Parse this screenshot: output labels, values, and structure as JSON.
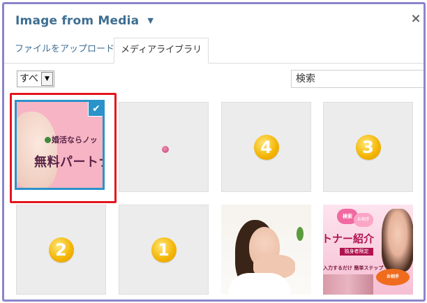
{
  "header": {
    "title": "Image from Media",
    "title_caret": "▼",
    "close_icon": "×"
  },
  "tabs": [
    {
      "label": "ファイルをアップロード",
      "active": false
    },
    {
      "label": "メディアライブラリ",
      "active": true
    }
  ],
  "filter": {
    "selected": "すべ",
    "arrow": "▼"
  },
  "search": {
    "value": "検索"
  },
  "grid": {
    "items": [
      {
        "kind": "ad",
        "selected": true,
        "line1": "婚活ならノッ",
        "line2": "無料パートナ"
      },
      {
        "kind": "dot",
        "selected": false
      },
      {
        "kind": "number",
        "value": "4",
        "selected": false
      },
      {
        "kind": "number",
        "value": "3",
        "selected": false
      },
      {
        "kind": "number",
        "value": "2",
        "selected": false
      },
      {
        "kind": "number",
        "value": "1",
        "selected": false
      },
      {
        "kind": "photo-woman",
        "selected": false
      },
      {
        "kind": "promo",
        "selected": false,
        "title": "トナー紹介",
        "sub": "独身者限定",
        "steps": "入力するだけ 簡単ステップ",
        "head1": "検索",
        "head2": "お相手",
        "badge": "お相手"
      }
    ],
    "check_icon": "✔"
  },
  "colors": {
    "frame": "#8b85c9",
    "selected_border": "#2a93c9",
    "highlight": "#e4161e",
    "badge": "#f3b300"
  }
}
